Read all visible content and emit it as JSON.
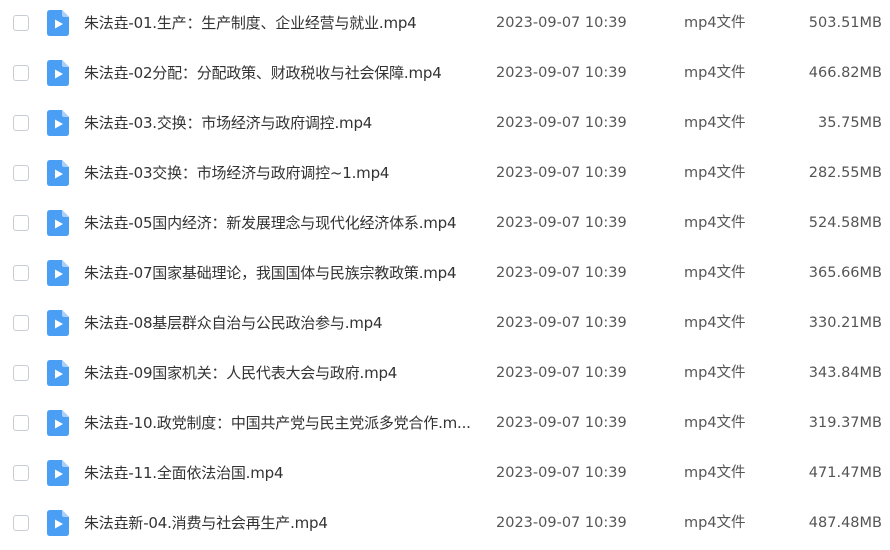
{
  "colors": {
    "icon_body": "#4a9ff5",
    "icon_fold": "#a9d0fb",
    "icon_play": "#ffffff",
    "text_primary": "#333333",
    "text_secondary": "#555555",
    "checkbox_border": "#c8ccd3"
  },
  "file_icon": "video-file-icon",
  "files": [
    {
      "name": "朱法垚-01.生产：生产制度、企业经营与就业.mp4",
      "date": "2023-09-07 10:39",
      "type": "mp4文件",
      "size": "503.51MB"
    },
    {
      "name": "朱法垚-02分配：分配政策、财政税收与社会保障.mp4",
      "date": "2023-09-07 10:39",
      "type": "mp4文件",
      "size": "466.82MB"
    },
    {
      "name": "朱法垚-03.交换：市场经济与政府调控.mp4",
      "date": "2023-09-07 10:39",
      "type": "mp4文件",
      "size": "35.75MB"
    },
    {
      "name": "朱法垚-03交换：市场经济与政府调控~1.mp4",
      "date": "2023-09-07 10:39",
      "type": "mp4文件",
      "size": "282.55MB"
    },
    {
      "name": "朱法垚-05国内经济：新发展理念与现代化经济体系.mp4",
      "date": "2023-09-07 10:39",
      "type": "mp4文件",
      "size": "524.58MB"
    },
    {
      "name": "朱法垚-07国家基础理论，我国国体与民族宗教政策.mp4",
      "date": "2023-09-07 10:39",
      "type": "mp4文件",
      "size": "365.66MB"
    },
    {
      "name": "朱法垚-08基层群众自治与公民政治参与.mp4",
      "date": "2023-09-07 10:39",
      "type": "mp4文件",
      "size": "330.21MB"
    },
    {
      "name": "朱法垚-09国家机关：人民代表大会与政府.mp4",
      "date": "2023-09-07 10:39",
      "type": "mp4文件",
      "size": "343.84MB"
    },
    {
      "name": "朱法垚-10.政党制度：中国共产党与民主党派多党合作.m...",
      "date": "2023-09-07 10:39",
      "type": "mp4文件",
      "size": "319.37MB"
    },
    {
      "name": "朱法垚-11.全面依法治国.mp4",
      "date": "2023-09-07 10:39",
      "type": "mp4文件",
      "size": "471.47MB"
    },
    {
      "name": "朱法垚新-04.消费与社会再生产.mp4",
      "date": "2023-09-07 10:39",
      "type": "mp4文件",
      "size": "487.48MB"
    }
  ]
}
